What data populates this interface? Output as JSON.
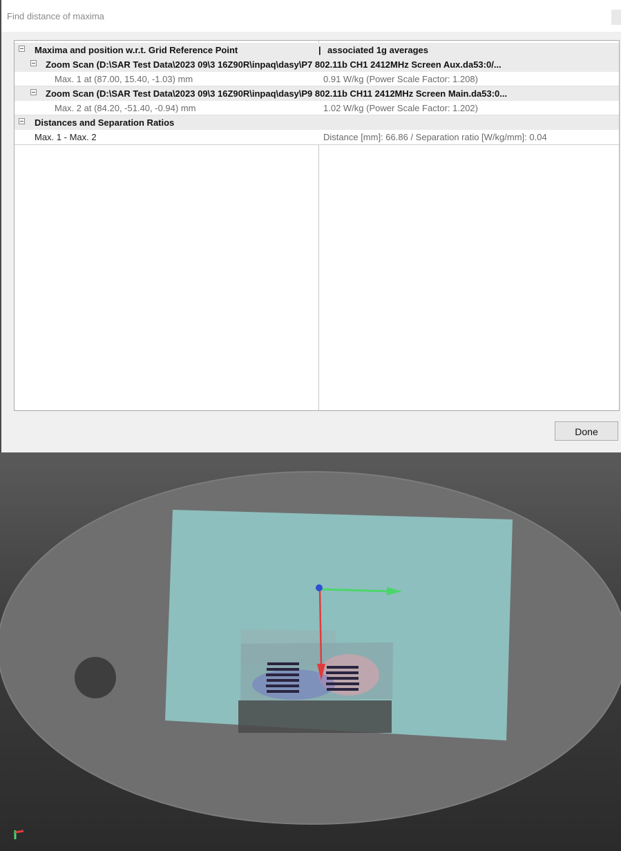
{
  "window": {
    "title": "Find distance of maxima"
  },
  "tree": {
    "header": {
      "label": "Maxima and position w.r.t. Grid Reference Point",
      "separator": "|",
      "right": "associated 1g averages"
    },
    "scans": [
      {
        "label": "Zoom Scan (D:\\SAR Test Data\\2023 09\\3 16Z90R\\inpaq\\dasy\\P7 802.11b CH1 2412MHz Screen Aux.da53:0/...",
        "max_label": "Max. 1 at (87.00, 15.40, -1.03) mm",
        "max_value": "0.91 W/kg (Power Scale Factor: 1.208)"
      },
      {
        "label": "Zoom Scan (D:\\SAR Test Data\\2023 09\\3 16Z90R\\inpaq\\dasy\\P9 802.11b CH11 2412MHz Screen Main.da53:0...",
        "max_label": "Max. 2 at (84.20, -51.40, -0.94) mm",
        "max_value": "1.02 W/kg (Power Scale Factor: 1.202)"
      }
    ],
    "distances": {
      "label": "Distances and Separation Ratios",
      "pair_label": "Max. 1 - Max. 2",
      "pair_value": "Distance [mm]: 66.86 / Separation ratio [W/kg/mm]: 0.04"
    }
  },
  "buttons": {
    "done": "Done"
  },
  "colors": {
    "phantom_plate": "#8fc3c2",
    "x_axis": "#4cd66a",
    "y_axis": "#e03c3c",
    "origin": "#2f4fd0",
    "phantom_base": "#6e6e6e"
  }
}
